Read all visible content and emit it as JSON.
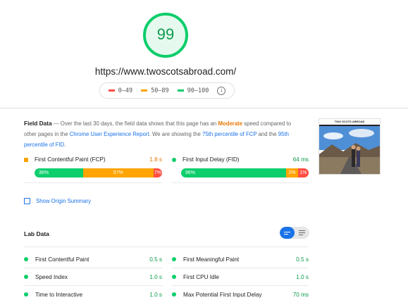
{
  "score": {
    "value": "99",
    "color": "#0cce6b"
  },
  "url": "https://www.twoscotsabroad.com/",
  "legend": [
    {
      "range": "0–49",
      "color": "#ff4e42"
    },
    {
      "range": "50–89",
      "color": "#ffa400"
    },
    {
      "range": "90–100",
      "color": "#0cce6b"
    }
  ],
  "field": {
    "title": "Field Data",
    "desc_1": " — Over the last 30 days, the field data shows that this page has an ",
    "moderate": "Moderate",
    "desc_2": " speed compared to other pages in the ",
    "link_crux": "Chrome User Experience Report",
    "desc_3": ". We are showing the ",
    "link_fcp": "75th percentile of FCP",
    "desc_4": " and the ",
    "link_fid": "95th percentile of FID",
    "desc_5": ".",
    "fcp": {
      "name": "First Contentful Paint (FCP)",
      "value": "1.8 s",
      "good": "36%",
      "avg": "57%",
      "poor": "7%",
      "good_frac": 0.36,
      "avg_frac": 0.57,
      "poor_frac": 0.07
    },
    "fid": {
      "name": "First Input Delay (FID)",
      "value": "64 ms",
      "good": "96%",
      "avg": "2%",
      "poor": "1%",
      "good_frac": 0.83,
      "avg_frac": 0.08,
      "poor_frac": 0.09
    },
    "thumb_title": "TWO SCOTS ABROAD"
  },
  "origin_summary": "Show Origin Summary",
  "lab": {
    "title": "Lab Data",
    "left": [
      {
        "name": "First Contentful Paint",
        "value": "0.5 s"
      },
      {
        "name": "Speed Index",
        "value": "1.0 s"
      },
      {
        "name": "Time to Interactive",
        "value": "1.0 s"
      }
    ],
    "right": [
      {
        "name": "First Meaningful Paint",
        "value": "0.5 s"
      },
      {
        "name": "First CPU Idle",
        "value": "1.0 s"
      },
      {
        "name": "Max Potential First Input Delay",
        "value": "70 ms"
      }
    ]
  },
  "colors": {
    "good": "#0cce6b",
    "average": "#ffa400",
    "poor": "#ff4e42",
    "link": "#1a73e8"
  },
  "icons": {
    "info": "info-icon",
    "toggle_list": "list-view-icon",
    "toggle_bars": "compact-view-icon"
  }
}
